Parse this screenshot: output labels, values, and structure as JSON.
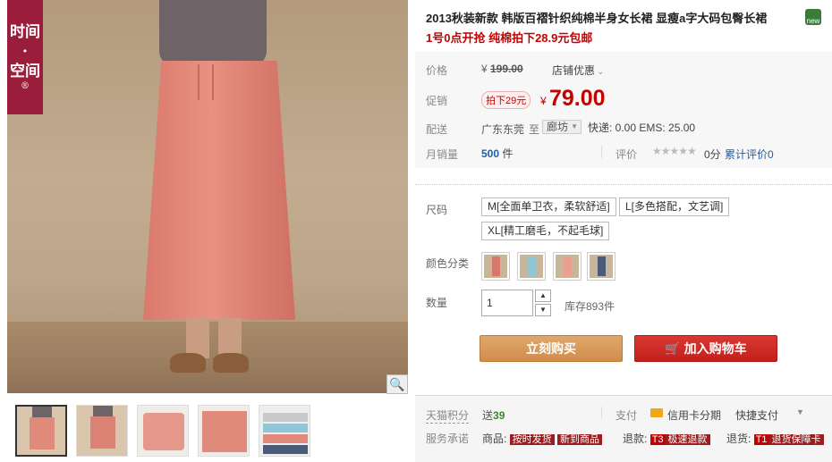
{
  "brand_tag": {
    "line1": "时间",
    "dot": "·",
    "line2": "空间",
    "reg": "®"
  },
  "product": {
    "title": "2013秋装新款 韩版百褶针织纯棉半身女长裙 显瘦a字大码包臀长裙",
    "subtitle": "1号0点开抢 纯棉拍下28.9元包邮",
    "tmall_badge": "new"
  },
  "price": {
    "label": "价格",
    "currency": "¥",
    "original": "199.00",
    "shop_discount": "店铺优惠"
  },
  "promo": {
    "label": "促销",
    "tag": "拍下29元",
    "currency": "¥",
    "value": "79.00"
  },
  "delivery": {
    "label": "配送",
    "from": "广东东莞",
    "to_word": "至",
    "city": "廊坊",
    "fees": "快递: 0.00 EMS: 25.00"
  },
  "sales": {
    "label": "月销量",
    "count": "500",
    "unit": "件",
    "rating_label": "评价",
    "stars": "★★★★★",
    "score": "0分",
    "cumulative": "累计评价0"
  },
  "sku": {
    "size_label": "尺码",
    "sizes": [
      "M[全面单卫衣，柔软舒适]",
      "L[多色搭配，文艺调]",
      "XL[精工磨毛，不起毛球]"
    ],
    "color_label": "颜色分类",
    "colors": [
      "#d9776c",
      "#8fc7d6",
      "#e9a08f",
      "#4c5a7a"
    ],
    "qty_label": "数量",
    "qty_value": "1",
    "stock": "库存893件"
  },
  "actions": {
    "buy_now": "立刻购买",
    "add_cart": "加入购物车",
    "cart_glyph": "🛒"
  },
  "footer": {
    "points_label": "天猫积分",
    "points_prefix": "送",
    "points_value": "39",
    "pay_label": "支付",
    "card_pay": "信用卡分期",
    "quick_pay": "快捷支付",
    "promise_label": "服务承诺",
    "goods_label": "商品:",
    "tag_fast": "按时发货",
    "tag_new": "新到商品",
    "refund_label": "退款:",
    "t3": "T3",
    "refund_fast": "极速退款",
    "return_label": "退货:",
    "t1": "T1",
    "return_guarantee": "退货保障卡"
  }
}
